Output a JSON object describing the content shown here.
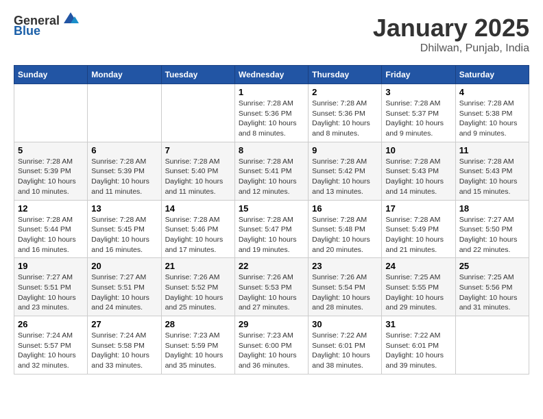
{
  "header": {
    "logo_general": "General",
    "logo_blue": "Blue",
    "month": "January 2025",
    "location": "Dhilwan, Punjab, India"
  },
  "weekdays": [
    "Sunday",
    "Monday",
    "Tuesday",
    "Wednesday",
    "Thursday",
    "Friday",
    "Saturday"
  ],
  "weeks": [
    [
      {
        "day": "",
        "info": ""
      },
      {
        "day": "",
        "info": ""
      },
      {
        "day": "",
        "info": ""
      },
      {
        "day": "1",
        "info": "Sunrise: 7:28 AM\nSunset: 5:36 PM\nDaylight: 10 hours\nand 8 minutes."
      },
      {
        "day": "2",
        "info": "Sunrise: 7:28 AM\nSunset: 5:36 PM\nDaylight: 10 hours\nand 8 minutes."
      },
      {
        "day": "3",
        "info": "Sunrise: 7:28 AM\nSunset: 5:37 PM\nDaylight: 10 hours\nand 9 minutes."
      },
      {
        "day": "4",
        "info": "Sunrise: 7:28 AM\nSunset: 5:38 PM\nDaylight: 10 hours\nand 9 minutes."
      }
    ],
    [
      {
        "day": "5",
        "info": "Sunrise: 7:28 AM\nSunset: 5:39 PM\nDaylight: 10 hours\nand 10 minutes."
      },
      {
        "day": "6",
        "info": "Sunrise: 7:28 AM\nSunset: 5:39 PM\nDaylight: 10 hours\nand 11 minutes."
      },
      {
        "day": "7",
        "info": "Sunrise: 7:28 AM\nSunset: 5:40 PM\nDaylight: 10 hours\nand 11 minutes."
      },
      {
        "day": "8",
        "info": "Sunrise: 7:28 AM\nSunset: 5:41 PM\nDaylight: 10 hours\nand 12 minutes."
      },
      {
        "day": "9",
        "info": "Sunrise: 7:28 AM\nSunset: 5:42 PM\nDaylight: 10 hours\nand 13 minutes."
      },
      {
        "day": "10",
        "info": "Sunrise: 7:28 AM\nSunset: 5:43 PM\nDaylight: 10 hours\nand 14 minutes."
      },
      {
        "day": "11",
        "info": "Sunrise: 7:28 AM\nSunset: 5:43 PM\nDaylight: 10 hours\nand 15 minutes."
      }
    ],
    [
      {
        "day": "12",
        "info": "Sunrise: 7:28 AM\nSunset: 5:44 PM\nDaylight: 10 hours\nand 16 minutes."
      },
      {
        "day": "13",
        "info": "Sunrise: 7:28 AM\nSunset: 5:45 PM\nDaylight: 10 hours\nand 16 minutes."
      },
      {
        "day": "14",
        "info": "Sunrise: 7:28 AM\nSunset: 5:46 PM\nDaylight: 10 hours\nand 17 minutes."
      },
      {
        "day": "15",
        "info": "Sunrise: 7:28 AM\nSunset: 5:47 PM\nDaylight: 10 hours\nand 19 minutes."
      },
      {
        "day": "16",
        "info": "Sunrise: 7:28 AM\nSunset: 5:48 PM\nDaylight: 10 hours\nand 20 minutes."
      },
      {
        "day": "17",
        "info": "Sunrise: 7:28 AM\nSunset: 5:49 PM\nDaylight: 10 hours\nand 21 minutes."
      },
      {
        "day": "18",
        "info": "Sunrise: 7:27 AM\nSunset: 5:50 PM\nDaylight: 10 hours\nand 22 minutes."
      }
    ],
    [
      {
        "day": "19",
        "info": "Sunrise: 7:27 AM\nSunset: 5:51 PM\nDaylight: 10 hours\nand 23 minutes."
      },
      {
        "day": "20",
        "info": "Sunrise: 7:27 AM\nSunset: 5:51 PM\nDaylight: 10 hours\nand 24 minutes."
      },
      {
        "day": "21",
        "info": "Sunrise: 7:26 AM\nSunset: 5:52 PM\nDaylight: 10 hours\nand 25 minutes."
      },
      {
        "day": "22",
        "info": "Sunrise: 7:26 AM\nSunset: 5:53 PM\nDaylight: 10 hours\nand 27 minutes."
      },
      {
        "day": "23",
        "info": "Sunrise: 7:26 AM\nSunset: 5:54 PM\nDaylight: 10 hours\nand 28 minutes."
      },
      {
        "day": "24",
        "info": "Sunrise: 7:25 AM\nSunset: 5:55 PM\nDaylight: 10 hours\nand 29 minutes."
      },
      {
        "day": "25",
        "info": "Sunrise: 7:25 AM\nSunset: 5:56 PM\nDaylight: 10 hours\nand 31 minutes."
      }
    ],
    [
      {
        "day": "26",
        "info": "Sunrise: 7:24 AM\nSunset: 5:57 PM\nDaylight: 10 hours\nand 32 minutes."
      },
      {
        "day": "27",
        "info": "Sunrise: 7:24 AM\nSunset: 5:58 PM\nDaylight: 10 hours\nand 33 minutes."
      },
      {
        "day": "28",
        "info": "Sunrise: 7:23 AM\nSunset: 5:59 PM\nDaylight: 10 hours\nand 35 minutes."
      },
      {
        "day": "29",
        "info": "Sunrise: 7:23 AM\nSunset: 6:00 PM\nDaylight: 10 hours\nand 36 minutes."
      },
      {
        "day": "30",
        "info": "Sunrise: 7:22 AM\nSunset: 6:01 PM\nDaylight: 10 hours\nand 38 minutes."
      },
      {
        "day": "31",
        "info": "Sunrise: 7:22 AM\nSunset: 6:01 PM\nDaylight: 10 hours\nand 39 minutes."
      },
      {
        "day": "",
        "info": ""
      }
    ]
  ]
}
